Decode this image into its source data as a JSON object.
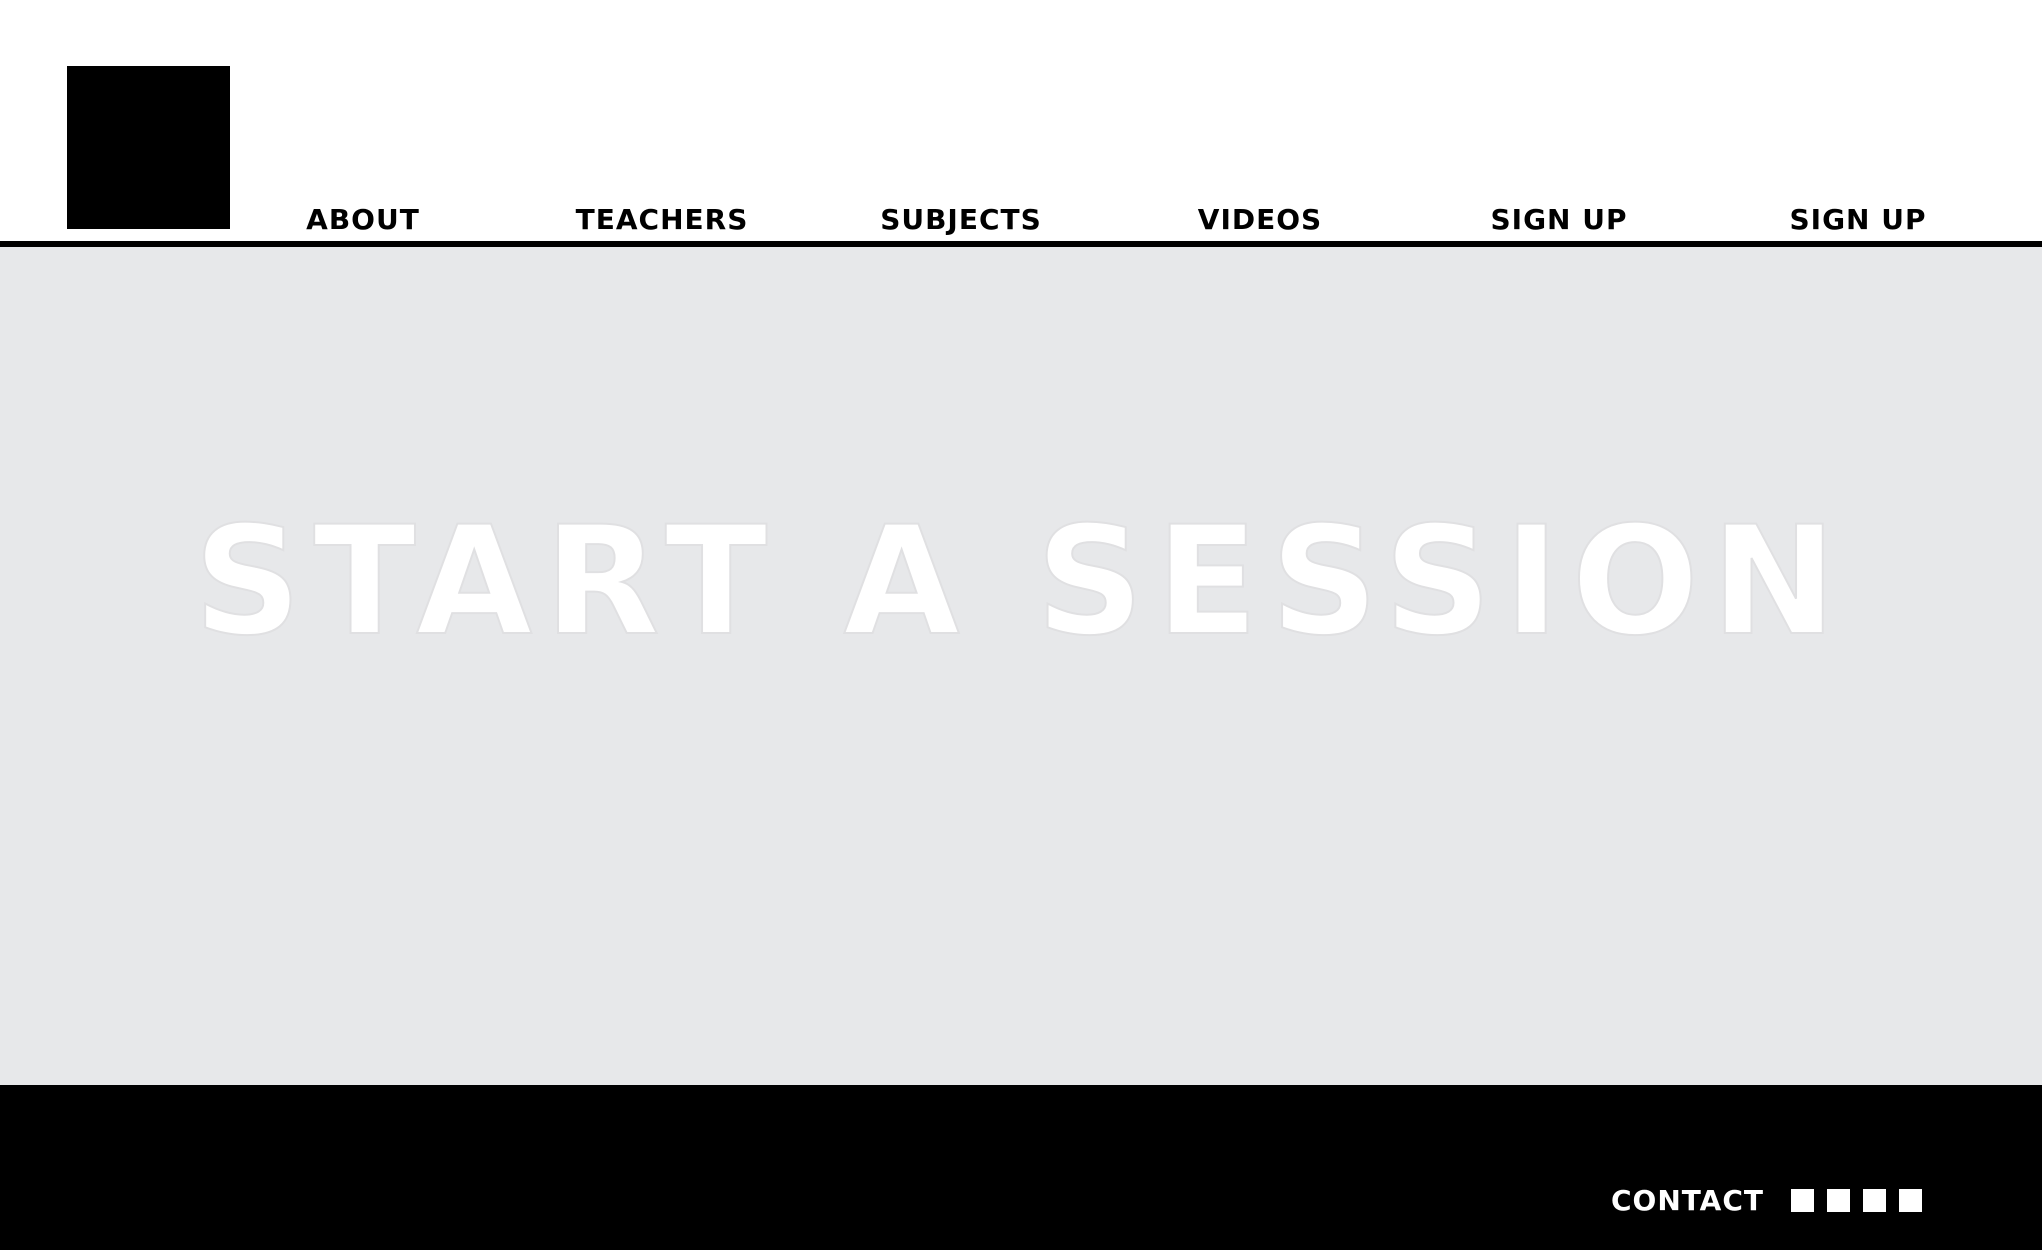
{
  "nav": {
    "items": [
      {
        "label": "ABOUT"
      },
      {
        "label": "TEACHERS"
      },
      {
        "label": "SUBJECTS"
      },
      {
        "label": "VIDEOS"
      },
      {
        "label": "SIGN UP"
      },
      {
        "label": "SIGN UP"
      }
    ]
  },
  "hero": {
    "title": "START A SESSION"
  },
  "footer": {
    "contact_label": "CONTACT",
    "social_icons": [
      "social-icon-1",
      "social-icon-2",
      "social-icon-3",
      "social-icon-4"
    ]
  },
  "colors": {
    "header_bg": "#ffffff",
    "hero_bg": "#e7e8ea",
    "footer_bg": "#000000",
    "text_dark": "#000000",
    "text_light": "#ffffff"
  }
}
